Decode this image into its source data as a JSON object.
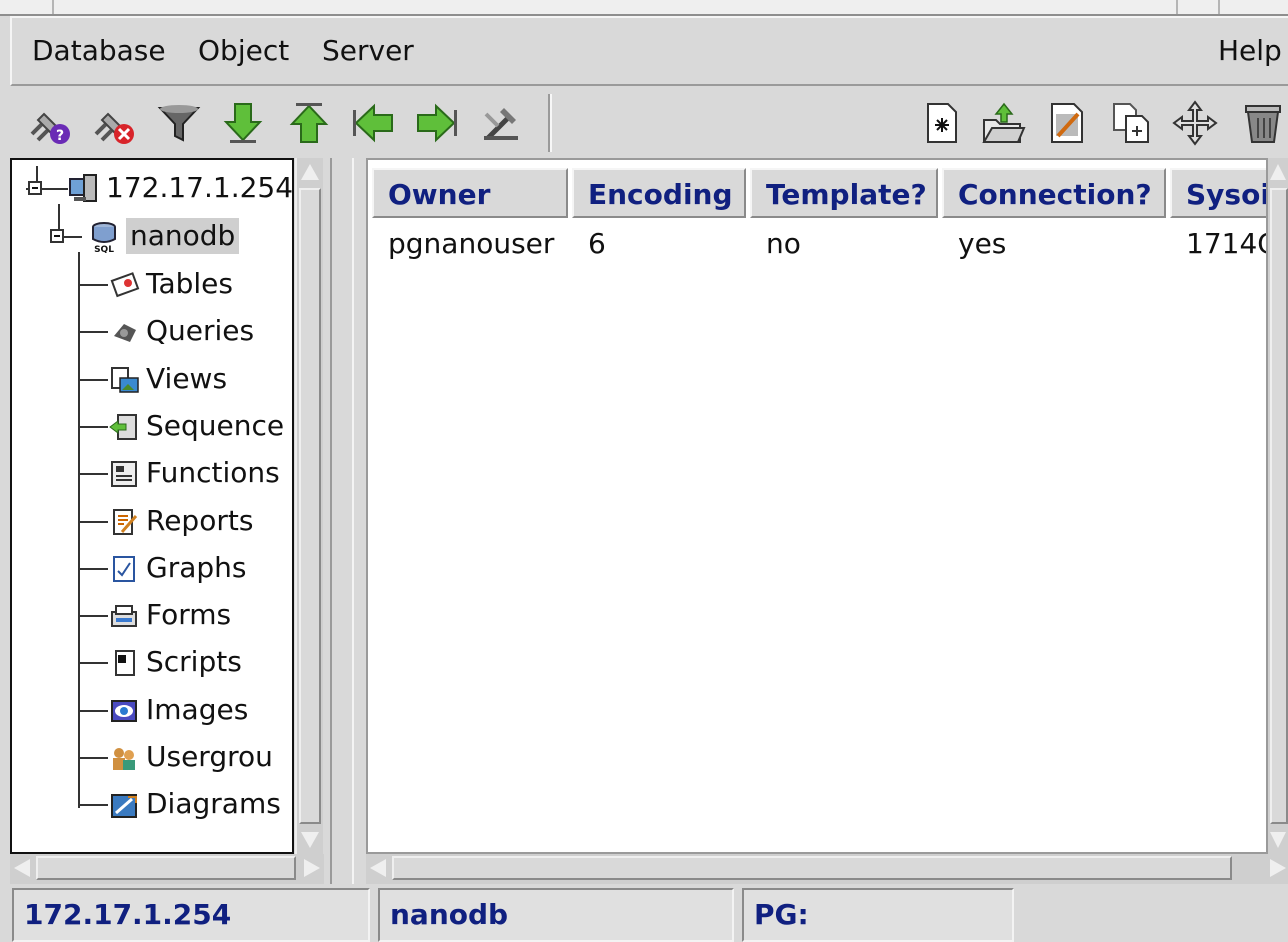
{
  "menubar": {
    "items": [
      "Database",
      "Object",
      "Server"
    ],
    "help": "Help"
  },
  "toolbar": {
    "left_icons": [
      "connect-help-icon",
      "disconnect-icon",
      "filter-icon",
      "arrow-down-icon",
      "arrow-up-icon",
      "arrow-left-icon",
      "arrow-right-icon",
      "tools-icon"
    ],
    "right_icons": [
      "new-icon",
      "open-icon",
      "edit-icon",
      "copy-icon",
      "move-icon",
      "delete-icon"
    ]
  },
  "tree": {
    "server": "172.17.1.254",
    "database": "nanodb",
    "items": [
      "Tables",
      "Queries",
      "Views",
      "Sequence",
      "Functions",
      "Reports",
      "Graphs",
      "Forms",
      "Scripts",
      "Images",
      "Usergrou",
      "Diagrams"
    ]
  },
  "grid": {
    "columns": [
      "Owner",
      "Encoding",
      "Template?",
      "Connection?",
      "Sysoi"
    ],
    "rows": [
      [
        "pgnanouser",
        "6",
        "no",
        "yes",
        "1714C"
      ]
    ]
  },
  "status": {
    "server": "172.17.1.254",
    "database": "nanodb",
    "pg": "PG:"
  }
}
